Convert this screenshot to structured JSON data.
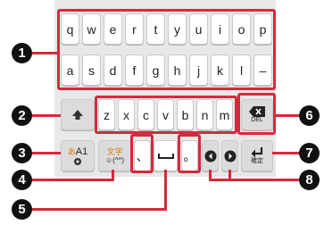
{
  "keyboard": {
    "row1": [
      "q",
      "w",
      "e",
      "r",
      "t",
      "y",
      "u",
      "i",
      "o",
      "p"
    ],
    "row2": [
      "a",
      "s",
      "d",
      "f",
      "g",
      "h",
      "j",
      "k",
      "l",
      "–"
    ],
    "row3": [
      "z",
      "x",
      "c",
      "v",
      "b",
      "n",
      "m"
    ],
    "delete_label": "DEL",
    "mode_label": "A1",
    "mode_prefix": "あ",
    "moji_label": "文字",
    "emoji_label": "☺(^^)",
    "comma_label": "、",
    "period_label": "。",
    "enter_label": "確定"
  },
  "callouts": [
    "1",
    "2",
    "3",
    "4",
    "5",
    "6",
    "7",
    "8"
  ],
  "colors": {
    "accent": "#d42a3e",
    "badge": "#111111"
  }
}
